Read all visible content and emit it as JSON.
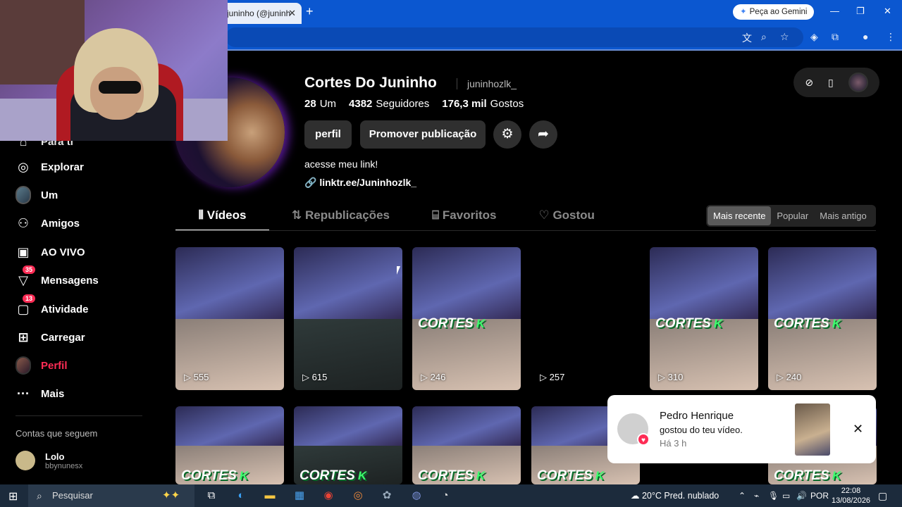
{
  "browser": {
    "tab_title": "juninho (@juninh",
    "tab_close": "✕",
    "new_tab": "+",
    "gemini_button": "Peça ao Gemini",
    "window_controls": [
      "—",
      "❐",
      "✕"
    ]
  },
  "sidebar": {
    "partial_item": "Para ti",
    "items": [
      {
        "label": "Explorar",
        "icon": "compass-icon",
        "glyph": "◎"
      },
      {
        "label": "Um",
        "icon": "avatar",
        "glyph": ""
      },
      {
        "label": "Amigos",
        "icon": "friends-icon",
        "glyph": "👥"
      },
      {
        "label": "AO VIVO",
        "icon": "live-icon",
        "glyph": "📺"
      },
      {
        "label": "Mensagens",
        "icon": "messages-icon",
        "glyph": "▽",
        "badge": "35"
      },
      {
        "label": "Atividade",
        "icon": "activity-icon",
        "glyph": "▢",
        "badge": "13"
      },
      {
        "label": "Carregar",
        "icon": "upload-icon",
        "glyph": "⊞"
      },
      {
        "label": "Perfil",
        "icon": "profile-avatar",
        "glyph": ""
      },
      {
        "label": "Mais",
        "icon": "more-icon",
        "glyph": "···"
      }
    ],
    "following_title": "Contas que seguem",
    "following": [
      {
        "name": "Lolo",
        "username": "bbynunesx"
      }
    ],
    "profile_color": "#fe2c55"
  },
  "profile": {
    "name": "Cortes Do Juninho",
    "username": "juninhozlk_",
    "stats": [
      {
        "value": "28",
        "label": "Um"
      },
      {
        "value": "4382",
        "label": "Seguidores"
      },
      {
        "value": "176,3 mil",
        "label": "Gostos"
      }
    ],
    "buttons": {
      "edit": "perfil",
      "promote": "Promover publicação",
      "settings_icon": "⚙",
      "share_icon": "➦"
    },
    "bio": "acesse meu link!",
    "link": "linktr.ee/Juninhozlk_"
  },
  "tabs": [
    {
      "label": "Vídeos",
      "icon": "⦀",
      "active": true
    },
    {
      "label": "Republicações",
      "icon": "⇅",
      "active": false
    },
    {
      "label": "Favoritos",
      "icon": "⌸",
      "active": false
    },
    {
      "label": "Gostou",
      "icon": "♡",
      "active": false
    }
  ],
  "sort": {
    "options": [
      "Mais recente",
      "Popular",
      "Mais antigo"
    ],
    "selected": "Mais recente"
  },
  "videos_row1": [
    {
      "views": "555",
      "brand": false
    },
    {
      "views": "615",
      "brand": false
    },
    {
      "views": "246",
      "brand": true
    },
    {
      "views": "257",
      "brand": false,
      "empty": true
    },
    {
      "views": "310",
      "brand": true
    },
    {
      "views": "240",
      "brand": true
    }
  ],
  "videos_row2": [
    {
      "brand": true
    },
    {
      "brand": true
    },
    {
      "brand": true
    },
    {
      "brand": true
    },
    {
      "brand": false
    },
    {
      "brand": true
    }
  ],
  "brand_text": {
    "main": "CORTES",
    "k": "K"
  },
  "notification": {
    "name": "Pedro Henrique",
    "message": "gostou do teu vídeo.",
    "time": "Há 3 h",
    "close": "✕"
  },
  "taskbar": {
    "search_placeholder": "Pesquisar",
    "weather": "20°C  Pred. nublado",
    "lang": "POR",
    "time": "22:08",
    "date": "13/08/2026"
  }
}
